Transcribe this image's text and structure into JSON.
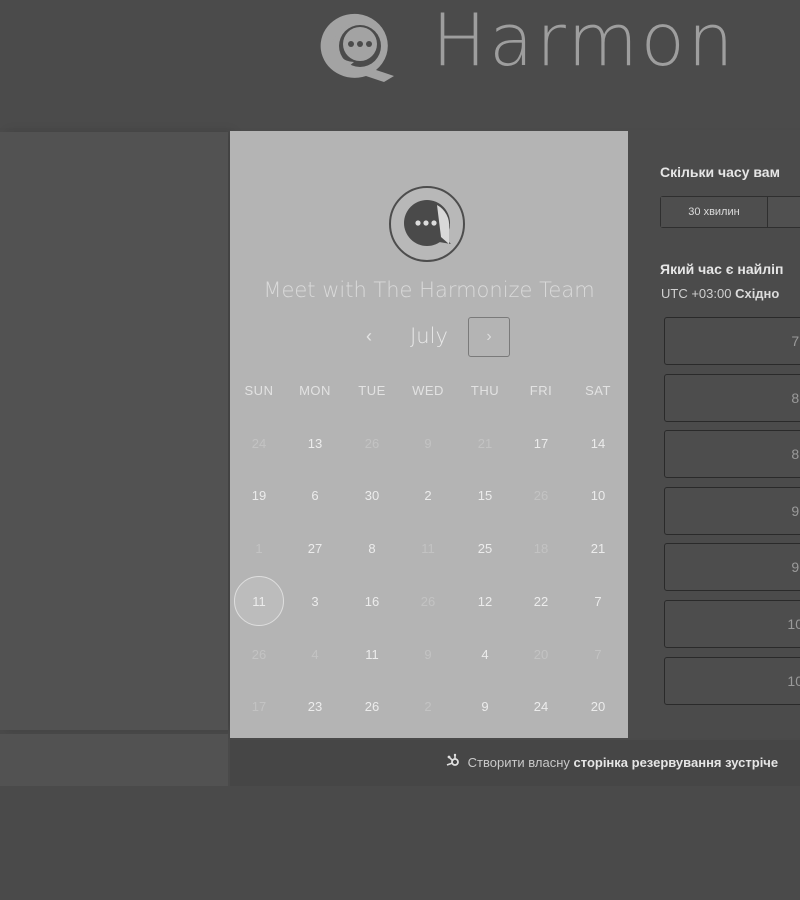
{
  "header": {
    "brand": "Harmon"
  },
  "calendar": {
    "title": "Meet with The Harmonize Team",
    "month": "July",
    "prev_label": "‹",
    "next_label": "›",
    "weekdays": [
      "SUN",
      "MON",
      "TUE",
      "WED",
      "THU",
      "FRI",
      "SAT"
    ],
    "weeks": [
      [
        "24",
        "13",
        "26",
        "9",
        "21",
        "17",
        "14"
      ],
      [
        "19",
        "6",
        "30",
        "2",
        "15",
        "26",
        "10"
      ],
      [
        "1",
        "27",
        "8",
        "11",
        "25",
        "18",
        "21"
      ],
      [
        "11",
        "3",
        "16",
        "26",
        "12",
        "22",
        "7"
      ],
      [
        "26",
        "4",
        "11",
        "9",
        "4",
        "20",
        "7"
      ],
      [
        "17",
        "23",
        "26",
        "2",
        "9",
        "24",
        "20"
      ]
    ],
    "selected_day": "11"
  },
  "booking": {
    "duration_question": "Скільки часу вам",
    "durations": [
      "30 хвилин"
    ],
    "time_question": "Який час є найліп",
    "timezone_prefix": "UTC +03:00",
    "timezone_name": "Східно",
    "slots": [
      "7:",
      "8:",
      "8:",
      "9:",
      "9:",
      "10",
      "10"
    ]
  },
  "footer": {
    "prefix": "Створити власну",
    "link": "сторінка резервування зустріче"
  },
  "colors": {
    "accent": "#e0e0e0",
    "calendar_bg": "#b4b4b4",
    "page_bg": "#4a4a4a"
  },
  "icons": {
    "logo": "chat-bubble-icon",
    "footer": "sprocket-icon"
  }
}
